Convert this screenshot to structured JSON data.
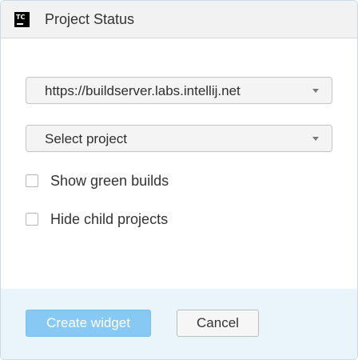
{
  "dialog": {
    "title": "Project Status",
    "logo_text": "TC",
    "logo_icon": "teamcity-logo-icon"
  },
  "form": {
    "server_select": {
      "selected": "https://buildserver.labs.intellij.net"
    },
    "project_select": {
      "selected": "Select project"
    },
    "checkboxes": [
      {
        "label": "Show green builds",
        "checked": false
      },
      {
        "label": "Hide child projects",
        "checked": false
      }
    ]
  },
  "footer": {
    "create_label": "Create widget",
    "create_enabled": false,
    "cancel_label": "Cancel"
  },
  "colors": {
    "primary_button": "#87c9f4",
    "footer_background": "#e9f4fb",
    "titlebar_background": "#f2f2f2"
  }
}
